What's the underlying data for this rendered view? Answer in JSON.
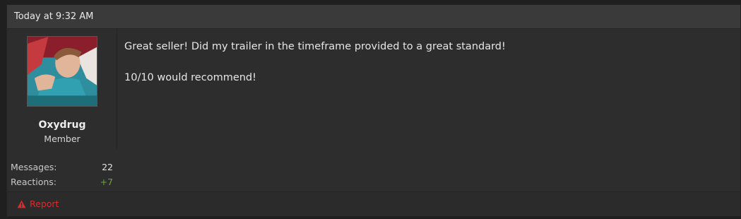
{
  "post": {
    "timestamp": "Today at 9:32 AM",
    "author": {
      "username": "Oxydrug",
      "title": "Member",
      "avatar_icon": "avatar-photo"
    },
    "stats": [
      {
        "label": "Messages:",
        "value": "22",
        "positive": false
      },
      {
        "label": "Reactions:",
        "value": "+7",
        "positive": true
      }
    ],
    "message": {
      "line1": "Great seller! Did my trailer in the timeframe provided to a great standard!",
      "line2": "10/10 would recommend!"
    },
    "footer": {
      "report_label": "Report",
      "report_icon": "warning-icon"
    },
    "colors": {
      "report": "#e0292c",
      "positive": "#6aa43a"
    }
  }
}
